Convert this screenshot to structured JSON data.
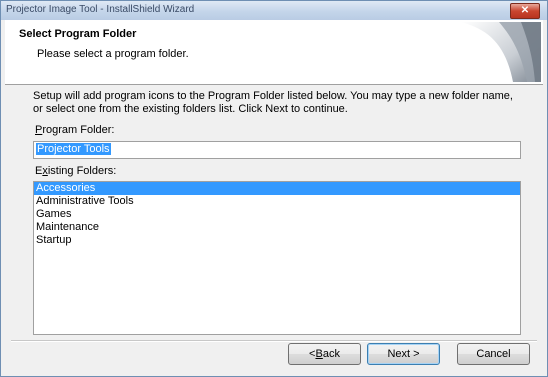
{
  "window": {
    "title": "Projector Image Tool - InstallShield Wizard"
  },
  "header": {
    "title": "Select Program Folder",
    "subtitle": "Please select a program folder."
  },
  "description": "Setup will add program icons to the Program Folder listed below.  You may type a new folder name, or select one from the existing folders list.  Click Next to continue.",
  "program_folder": {
    "label_access": "P",
    "label_rest": "rogram Folder:",
    "value": "Projector Tools"
  },
  "existing_folders": {
    "label_pre": "E",
    "label_access": "x",
    "label_rest": "isting Folders:",
    "items": [
      "Accessories",
      "Administrative Tools",
      "Games",
      "Maintenance",
      "Startup"
    ],
    "selected_index": 0
  },
  "buttons": {
    "back_prefix": "< ",
    "back_access": "B",
    "back_rest": "ack",
    "next": "Next >",
    "cancel": "Cancel"
  },
  "colors": {
    "selection": "#3399ff",
    "title_bar": "#c4d5ea",
    "close": "#c9452f"
  }
}
